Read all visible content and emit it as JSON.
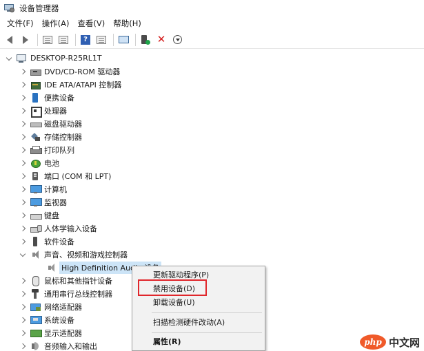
{
  "window": {
    "title": "设备管理器"
  },
  "menu": [
    {
      "label": "文件(F)"
    },
    {
      "label": "操作(A)"
    },
    {
      "label": "查看(V)"
    },
    {
      "label": "帮助(H)"
    }
  ],
  "toolbar": {
    "icons": [
      "back-arrow-icon",
      "forward-arrow-icon",
      "properties-icon",
      "properties-sheet-icon",
      "help-icon",
      "view-icon",
      "monitor-icon",
      "update-driver-icon",
      "uninstall-icon",
      "download-icon"
    ]
  },
  "tree": {
    "root": "DESKTOP-R25RL1T",
    "categories": [
      {
        "label": "DVD/CD-ROM 驱动器",
        "icon": "dvd-drive-icon"
      },
      {
        "label": "IDE ATA/ATAPI 控制器",
        "icon": "ide-controller-icon"
      },
      {
        "label": "便携设备",
        "icon": "portable-device-icon"
      },
      {
        "label": "处理器",
        "icon": "processor-icon"
      },
      {
        "label": "磁盘驱动器",
        "icon": "disk-drive-icon"
      },
      {
        "label": "存储控制器",
        "icon": "storage-controller-icon"
      },
      {
        "label": "打印队列",
        "icon": "printer-icon"
      },
      {
        "label": "电池",
        "icon": "battery-icon"
      },
      {
        "label": "端口 (COM 和 LPT)",
        "icon": "port-icon"
      },
      {
        "label": "计算机",
        "icon": "computer-icon"
      },
      {
        "label": "监视器",
        "icon": "monitor-icon"
      },
      {
        "label": "键盘",
        "icon": "keyboard-icon"
      },
      {
        "label": "人体学输入设备",
        "icon": "hid-icon"
      },
      {
        "label": "软件设备",
        "icon": "software-device-icon"
      },
      {
        "label": "声音、视频和游戏控制器",
        "icon": "sound-icon",
        "expanded": true
      },
      {
        "label": "鼠标和其他指针设备",
        "icon": "mouse-icon"
      },
      {
        "label": "通用串行总线控制器",
        "icon": "usb-icon"
      },
      {
        "label": "网络适配器",
        "icon": "network-adapter-icon"
      },
      {
        "label": "系统设备",
        "icon": "system-device-icon"
      },
      {
        "label": "显示适配器",
        "icon": "display-adapter-icon"
      },
      {
        "label": "音频输入和输出",
        "icon": "audio-io-icon"
      }
    ],
    "selected_child": "High Definition Audio 设备"
  },
  "context_menu": {
    "items": [
      {
        "label": "更新驱动程序(P)",
        "bold": false
      },
      {
        "label": "禁用设备(D)",
        "bold": false,
        "highlighted": true
      },
      {
        "label": "卸载设备(U)",
        "bold": false
      },
      {
        "label": "扫描检测硬件改动(A)",
        "bold": false
      },
      {
        "label": "属性(R)",
        "bold": true
      }
    ],
    "highlight_color": "#e0262b"
  },
  "watermark": {
    "logo": "php",
    "text": "中文网"
  },
  "colors": {
    "selection": "#cce4f7",
    "menu_bg": "#f2f2f2",
    "accent_red": "#d42020"
  }
}
